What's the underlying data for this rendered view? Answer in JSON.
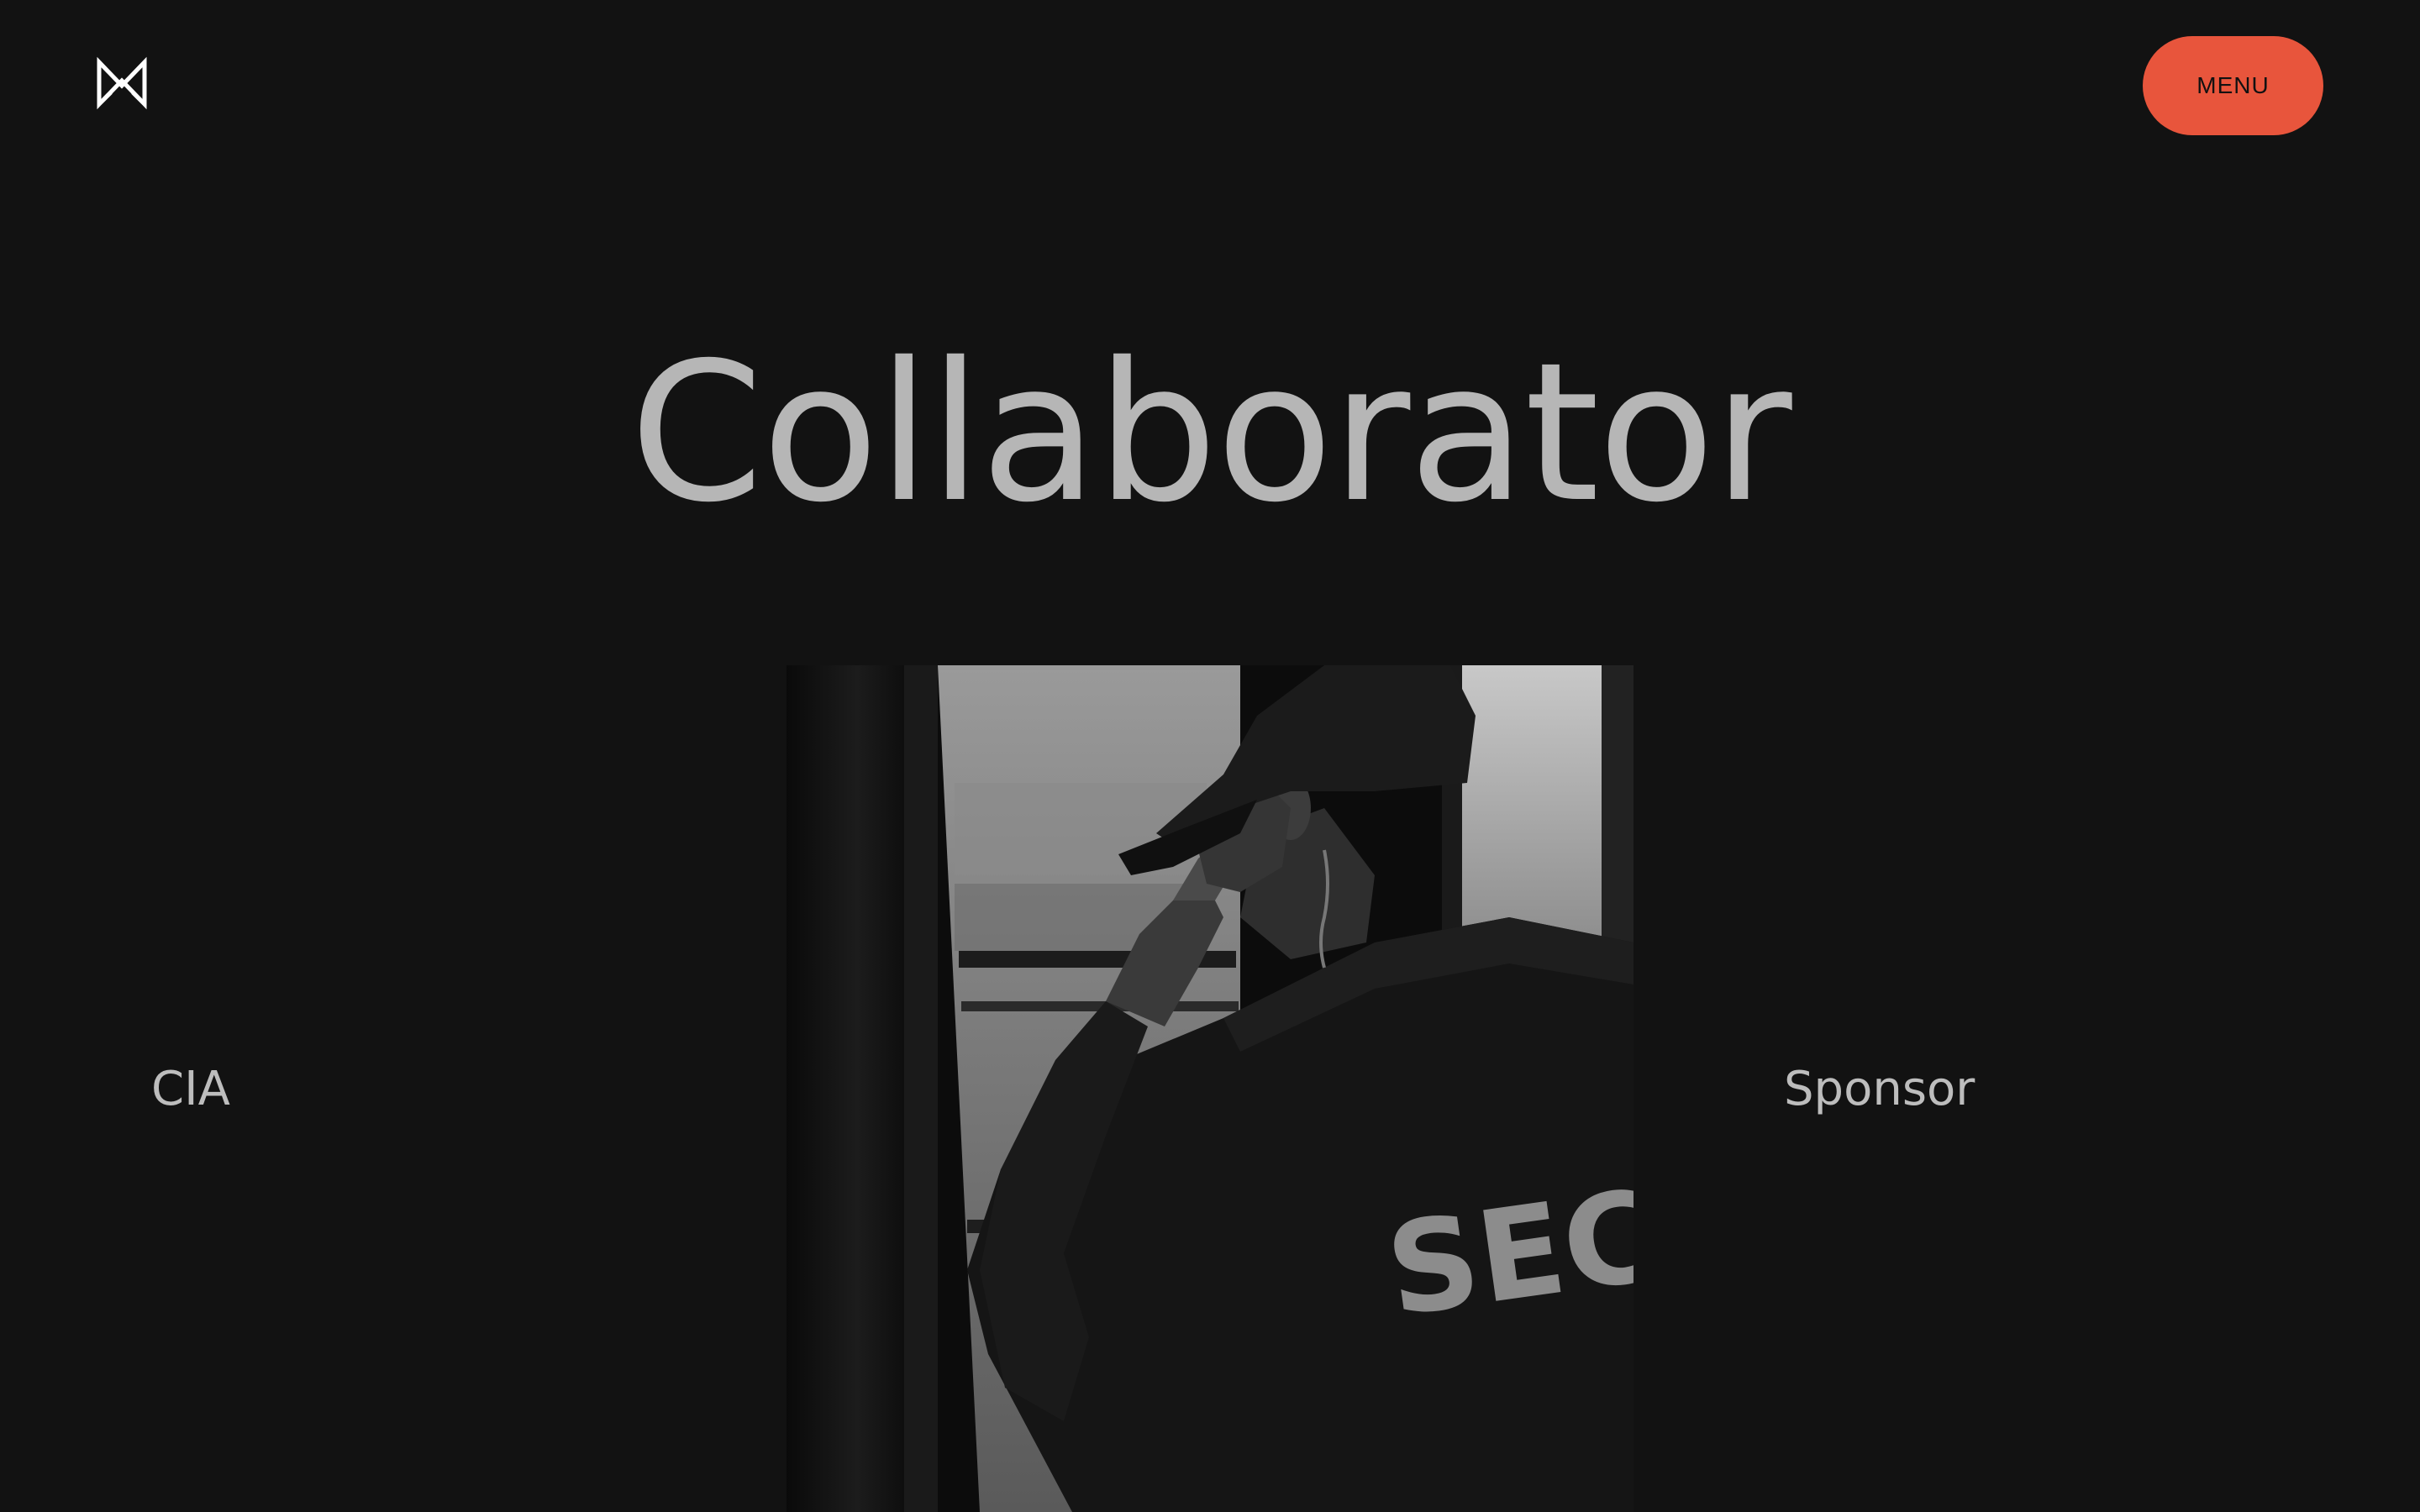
{
  "header": {
    "logo_icon": "m-logo-icon",
    "menu_label": "MENU",
    "menu_color": "#e8553c"
  },
  "hero": {
    "title": "Collaborator",
    "left_label": "CIA",
    "right_label": "Sponsor",
    "image": {
      "subject": "security-guard-photo",
      "jacket_text": "SECU"
    }
  },
  "colors": {
    "background": "#121212",
    "text": "#b6b6b6",
    "accent": "#e8553c"
  }
}
